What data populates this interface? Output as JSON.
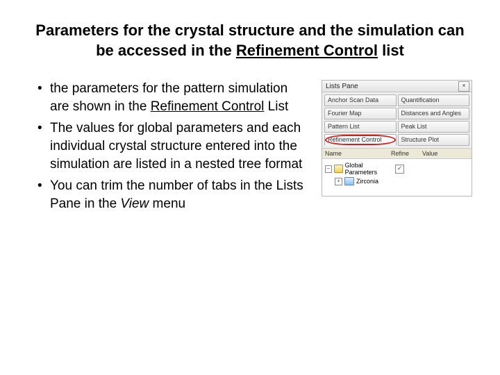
{
  "title": {
    "pre": "Parameters for the crystal structure and the simulation can be accessed in the ",
    "underlined": "Refinement Control",
    "post": " list"
  },
  "bullets": {
    "b1_pre": "the parameters for the pattern simulation are shown in the ",
    "b1_underlined": "Refinement Control",
    "b1_post": " List",
    "b2": "The values for global parameters and each individual crystal structure entered into the simulation are listed in a nested tree format",
    "b3_pre": "You can trim the number of tabs in the Lists Pane in the ",
    "b3_italic": "View",
    "b3_post": " menu"
  },
  "panel": {
    "title": "Lists Pane",
    "close": "×",
    "tabs": {
      "t1": "Anchor Scan Data",
      "t2": "Quantification",
      "t3": "Fourier Map",
      "t4": "Distances and Angles",
      "t5": "Pattern List",
      "t6": "Peak List",
      "t7": "Refinement Control",
      "t8": "Structure Plot"
    },
    "cols": {
      "name": "Name",
      "refine": "Refine",
      "value": "Value"
    },
    "tree": {
      "root_expander": "−",
      "root_label": "Global Parameters",
      "root_check": "✓",
      "child_expander": "+",
      "child_label": "Zirconia"
    }
  }
}
